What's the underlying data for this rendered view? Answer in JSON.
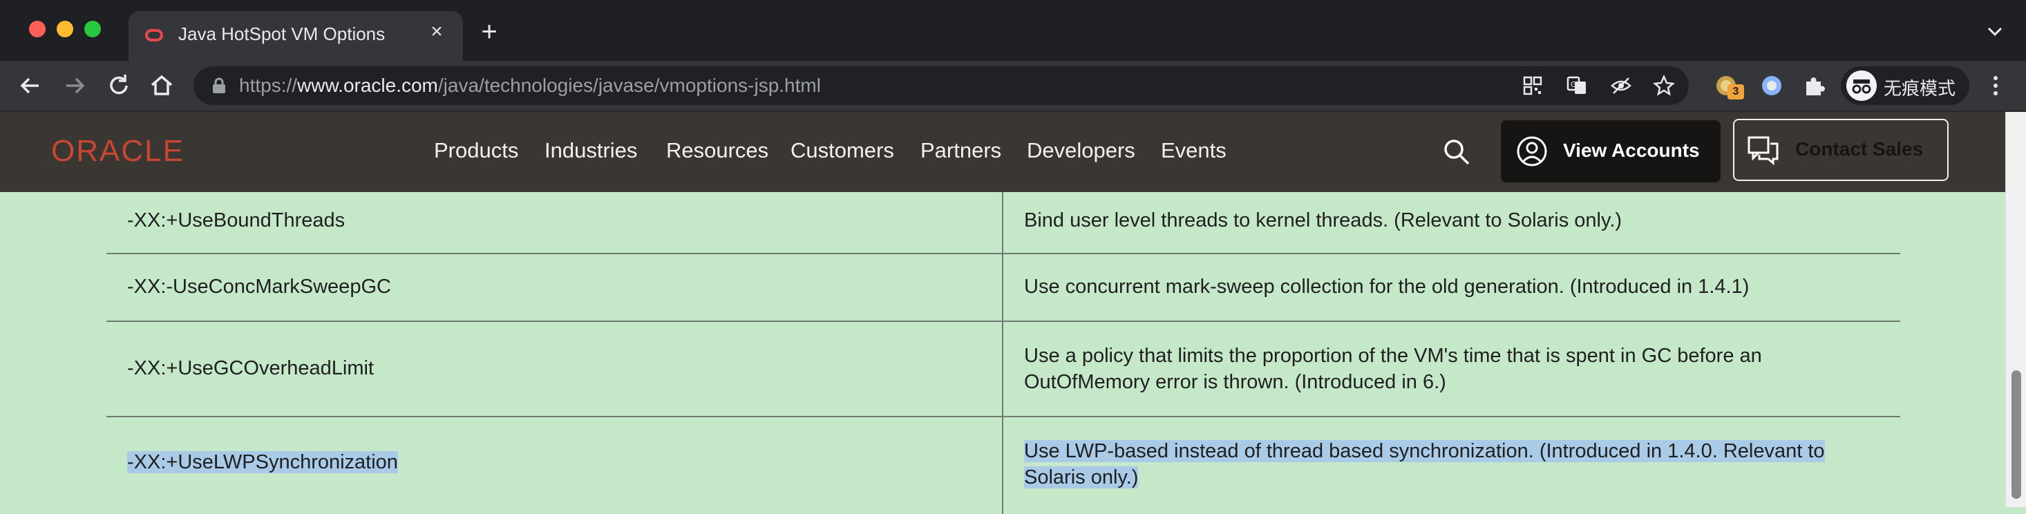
{
  "browser": {
    "tab": {
      "title": "Java HotSpot VM Options"
    },
    "address": {
      "scheme": "https://",
      "host": "www.oracle.com",
      "path": "/java/technologies/javase/vmoptions-jsp.html"
    },
    "extension_badge": "3",
    "profile_label": "无痕模式"
  },
  "site": {
    "logo": "ORACLE",
    "nav": [
      "Products",
      "Industries",
      "Resources",
      "Customers",
      "Partners",
      "Developers",
      "Events"
    ],
    "view_accounts": "View Accounts",
    "contact_sales": "Contact Sales"
  },
  "table": {
    "rows": [
      {
        "option": "-XX:+UseBoundThreads",
        "description": "Bind user level threads to kernel threads. (Relevant to Solaris only.)"
      },
      {
        "option": "-XX:-UseConcMarkSweepGC",
        "description": "Use concurrent mark-sweep collection for the old generation. (Introduced in 1.4.1)"
      },
      {
        "option": "-XX:+UseGCOverheadLimit",
        "description": "Use a policy that limits the proportion of the VM's time that is spent in GC before an OutOfMemory error is thrown. (Introduced in 6.)"
      },
      {
        "option": "-XX:+UseLWPSynchronization",
        "description": "Use LWP-based instead of thread based synchronization. (Introduced in 1.4.0. Relevant to Solaris only.)"
      }
    ]
  },
  "icons": {
    "back": "arrow-left-icon",
    "forward": "arrow-right-icon",
    "reload": "reload-icon",
    "home": "home-icon",
    "lock": "lock-icon",
    "search": "search-icon",
    "account": "user-circle-icon",
    "chat": "chat-icon"
  },
  "colors": {
    "oracle_red": "#c74634",
    "header_bg": "#3a3632",
    "table_bg": "#c5e8c9",
    "selection": "#a9cbe8"
  }
}
